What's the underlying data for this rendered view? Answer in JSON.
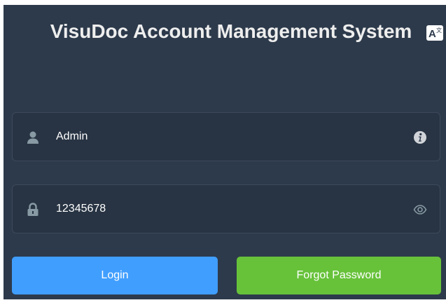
{
  "title": "VisuDoc Account Management System",
  "form": {
    "username": {
      "value": "Admin",
      "icon": "user-icon",
      "trailing_icon": "info-icon"
    },
    "password": {
      "value": "12345678",
      "icon": "lock-icon",
      "trailing_icon": "eye-icon"
    }
  },
  "buttons": {
    "login_label": "Login",
    "forgot_label": "Forgot Password"
  },
  "lang_switch_icon": "translate-icon",
  "colors": {
    "panel_bg": "#2d3a4b",
    "field_bg": "#283443",
    "login": "#409eff",
    "forgot": "#67c23a"
  }
}
